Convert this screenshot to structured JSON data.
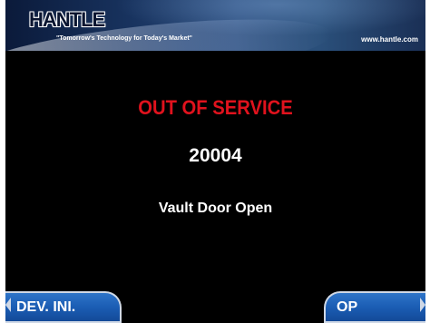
{
  "header": {
    "logo": "HANTLE",
    "tagline": "\"Tomorrow's Technology for Today's Market\"",
    "website": "www.hantle.com"
  },
  "status": {
    "title": "OUT OF SERVICE",
    "code": "20004",
    "message": "Vault Door Open"
  },
  "function_keys": {
    "left_label": "DEV. INI.",
    "right_label": "OP"
  },
  "colors": {
    "background": "#000000",
    "status_title": "#e0121d",
    "key_blue": "#1b5db4"
  }
}
